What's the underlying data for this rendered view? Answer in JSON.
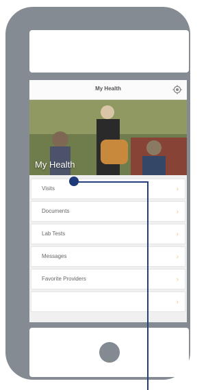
{
  "app": {
    "title": "My Health",
    "hero_title": "My Health"
  },
  "menu": {
    "items": [
      {
        "label": "Visits"
      },
      {
        "label": "Documents"
      },
      {
        "label": "Lab Tests"
      },
      {
        "label": "Messages"
      },
      {
        "label": "Favorite Providers"
      },
      {
        "label": ""
      }
    ]
  },
  "icons": {
    "settings": "gear-icon",
    "chevron": "chevron-right-icon"
  },
  "colors": {
    "device_frame": "#848b92",
    "callout": "#1f3a79",
    "chevron": "#f0c27a"
  }
}
